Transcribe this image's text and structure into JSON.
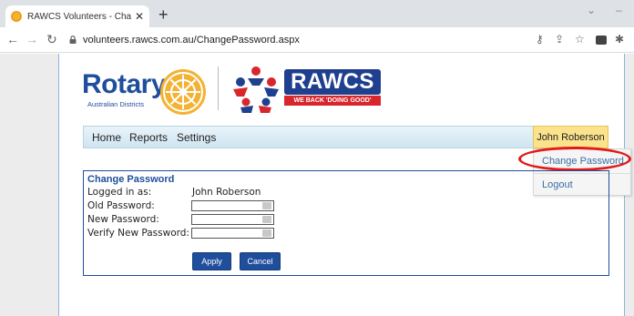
{
  "browser": {
    "tab_title": "RAWCS Volunteers - Change Pas",
    "tab_close": "✕",
    "new_tab": "+",
    "url": "volunteers.rawcs.com.au/ChangePassword.aspx"
  },
  "header": {
    "rotary_name": "Rotary",
    "rotary_sub": "Australian Districts",
    "rawcs_name": "RAWCS",
    "rawcs_tagline": "WE BACK 'DOING GOOD'"
  },
  "menu": {
    "items": [
      "Home",
      "Reports",
      "Settings"
    ],
    "user": "John Roberson"
  },
  "dropdown": {
    "items": [
      "Change Password",
      "Logout"
    ]
  },
  "form": {
    "title": "Change Password",
    "logged_in_label": "Logged in as:",
    "logged_in_value": "John Roberson",
    "old_password_label": "Old Password:",
    "new_password_label": "New Password:",
    "verify_password_label": "Verify New Password:",
    "apply_label": "Apply",
    "cancel_label": "Cancel"
  },
  "colors": {
    "brand_blue": "#1f4e9c",
    "user_menu_bg": "#fbe28c",
    "highlight_red": "#e11a1a"
  }
}
